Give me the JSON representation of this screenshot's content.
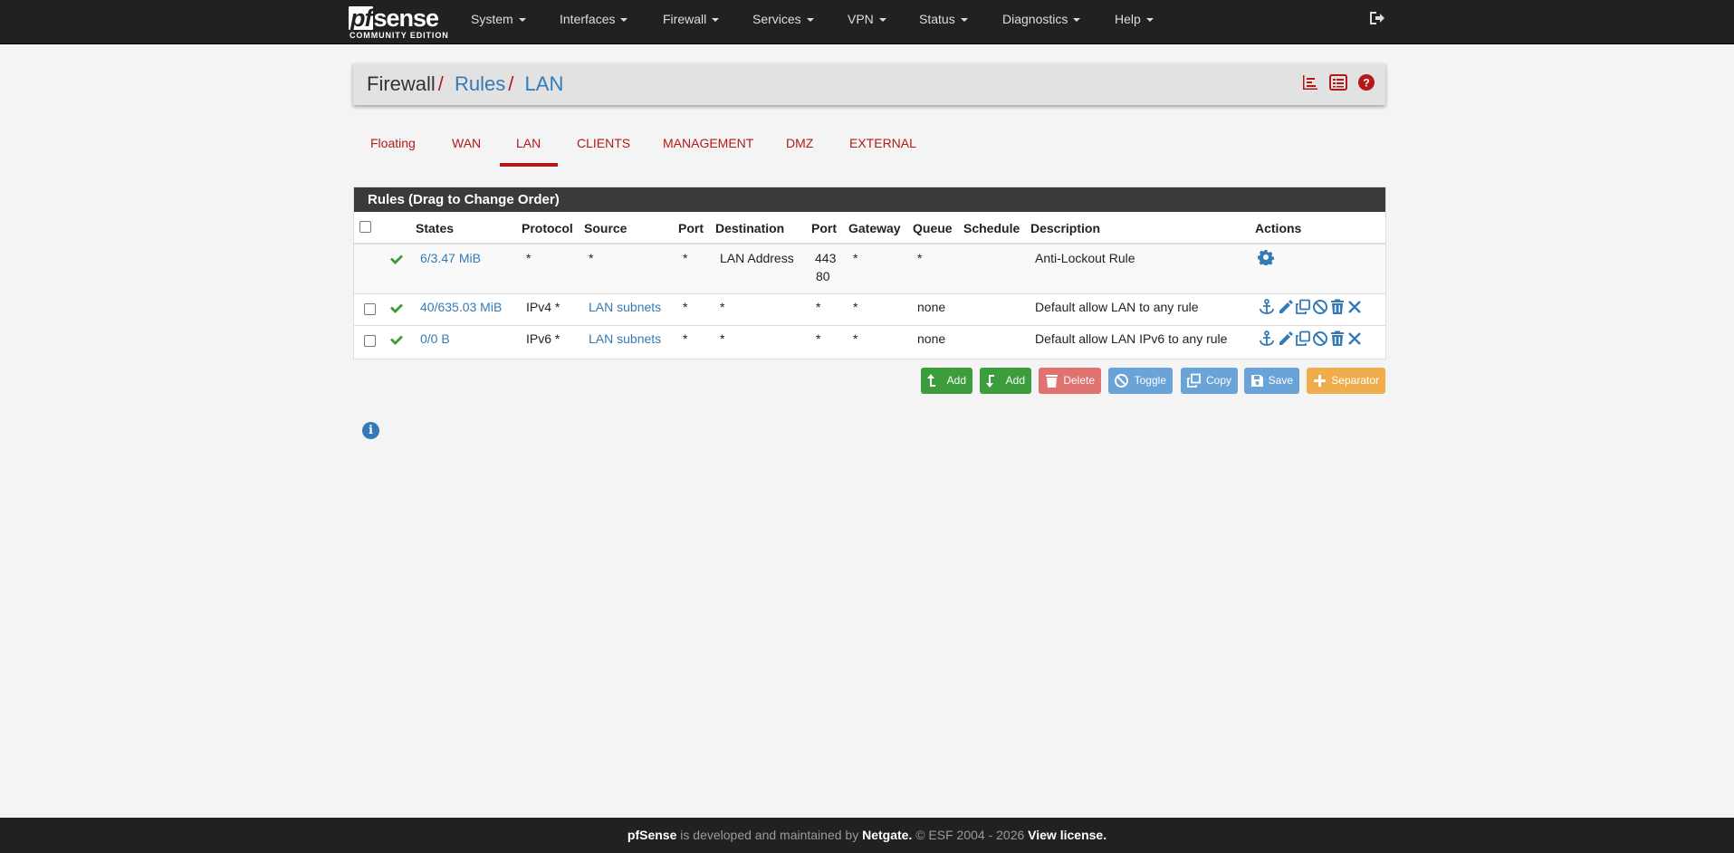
{
  "brand": {
    "logo_text": "pfsense",
    "edition": "COMMUNITY EDITION"
  },
  "menu": [
    "System",
    "Interfaces",
    "Firewall",
    "Services",
    "VPN",
    "Status",
    "Diagnostics",
    "Help"
  ],
  "breadcrumb": {
    "root": "Firewall",
    "level2": "Rules",
    "level3": "LAN",
    "separator": "/"
  },
  "tabs": [
    "Floating",
    "WAN",
    "LAN",
    "CLIENTS",
    "MANAGEMENT",
    "DMZ",
    "EXTERNAL"
  ],
  "active_tab": "LAN",
  "panel": {
    "title": "Rules (Drag to Change Order)",
    "headers": [
      "States",
      "Protocol",
      "Source",
      "Port",
      "Destination",
      "Port",
      "Gateway",
      "Queue",
      "Schedule",
      "Description",
      "Actions"
    ],
    "rows": [
      {
        "states": "6/3.47 MiB",
        "protocol": "*",
        "source": "*",
        "src_port": "*",
        "destination": "LAN Address",
        "dst_port_1": "443",
        "dst_port_2": "80",
        "gateway": "*",
        "queue": "*",
        "schedule": "",
        "description": "Anti-Lockout Rule"
      },
      {
        "states": "40/635.03 MiB",
        "protocol": "IPv4 *",
        "source": "LAN subnets",
        "src_port": "*",
        "destination": "*",
        "dst_port_1": "*",
        "gateway": "*",
        "queue": "none",
        "schedule": "",
        "description": "Default allow LAN to any rule"
      },
      {
        "states": "0/0 B",
        "protocol": "IPv6 *",
        "source": "LAN subnets",
        "src_port": "*",
        "destination": "*",
        "dst_port_1": "*",
        "gateway": "*",
        "queue": "none",
        "schedule": "",
        "description": "Default allow LAN IPv6 to any rule"
      }
    ]
  },
  "buttons": {
    "add_top": "Add",
    "add_bottom": "Add",
    "delete": "Delete",
    "toggle": "Toggle",
    "copy": "Copy",
    "save": "Save",
    "separator": "Separator"
  },
  "footer": {
    "product": "pfSense",
    "text1": " is developed and maintained by ",
    "company": "Netgate.",
    "text2": " © ESF 2004 - 2026 ",
    "license": "View license."
  },
  "colors": {
    "accent": "#b31919",
    "link": "#337ab7",
    "navbar": "#212121",
    "pass_check": "#3c9d3c"
  }
}
